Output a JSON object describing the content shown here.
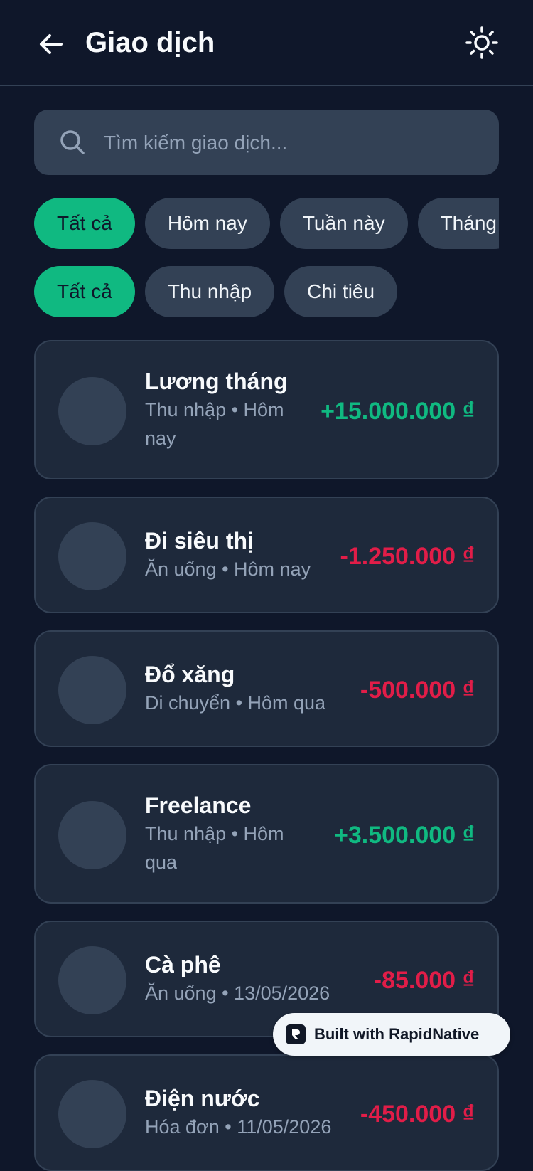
{
  "header": {
    "title": "Giao dịch",
    "back_icon": "arrow-left-icon",
    "theme_icon": "sun-icon"
  },
  "search": {
    "placeholder": "Tìm kiếm giao dịch...",
    "value": ""
  },
  "period_filters": [
    {
      "label": "Tất cả",
      "active": true
    },
    {
      "label": "Hôm nay",
      "active": false
    },
    {
      "label": "Tuần này",
      "active": false
    },
    {
      "label": "Tháng",
      "active": false
    }
  ],
  "type_filters": [
    {
      "label": "Tất cả",
      "active": true
    },
    {
      "label": "Thu nhập",
      "active": false
    },
    {
      "label": "Chi tiêu",
      "active": false
    }
  ],
  "transactions": [
    {
      "name": "Lương tháng",
      "meta": "Thu nhập • Hôm nay",
      "amount": "+15.000.000 ₫",
      "type": "income"
    },
    {
      "name": "Đi siêu thị",
      "meta": "Ăn uống • Hôm nay",
      "amount": "-1.250.000 ₫",
      "type": "expense"
    },
    {
      "name": "Đổ xăng",
      "meta": "Di chuyển • Hôm qua",
      "amount": "-500.000 ₫",
      "type": "expense"
    },
    {
      "name": "Freelance",
      "meta": "Thu nhập • Hôm qua",
      "amount": "+3.500.000 ₫",
      "type": "income"
    },
    {
      "name": "Cà phê",
      "meta": "Ăn uống • 13/05/2026",
      "amount": "-85.000 ₫",
      "type": "expense"
    },
    {
      "name": "Điện nước",
      "meta": "Hóa đơn • 11/05/2026",
      "amount": "-450.000 ₫",
      "type": "expense"
    }
  ],
  "badge": {
    "text": "Built with RapidNative"
  },
  "colors": {
    "background": "#0f172a",
    "card": "#1e293b",
    "accent": "#10b981",
    "income": "#10b981",
    "expense": "#e11d48"
  }
}
